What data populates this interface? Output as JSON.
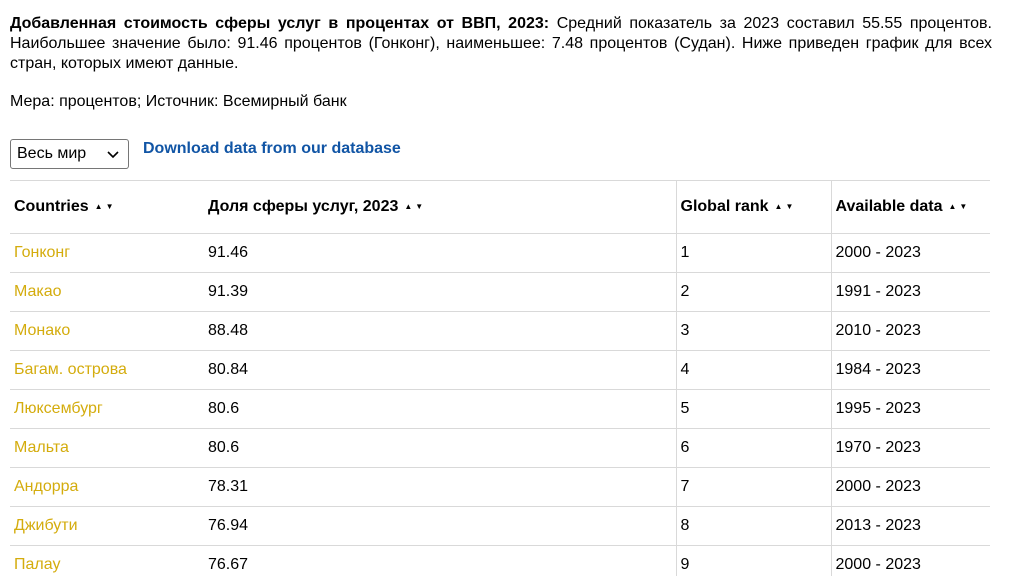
{
  "intro": {
    "title": "Добавленная стоимость сферы услуг в процентах от ВВП, 2023:",
    "text": "Средний показатель за 2023 составил 55.55 процентов. Наибольшее значение было: 91.46 процентов (Гонконг), наименьшее: 7.48 процентов (Судан). Ниже приведен график для всех стран, которых имеют данные."
  },
  "measure": "Мера: процентов; Источник: Всемирный банк",
  "region_select": {
    "value": "Весь мир",
    "icon": "chevron-down-icon"
  },
  "download_link": "Download data from our database",
  "colors": {
    "link": "#1155a5",
    "country": "#d4ac0d",
    "grid": "#d9d9d9"
  },
  "table": {
    "headers": {
      "country": "Countries",
      "value": "Доля сферы услуг, 2023",
      "rank": "Global rank",
      "available": "Available data"
    },
    "sort_arrows": "▲▼",
    "rows": [
      {
        "country": "Гонконг",
        "value": "91.46",
        "rank": "1",
        "available": "2000 - 2023"
      },
      {
        "country": "Макао",
        "value": "91.39",
        "rank": "2",
        "available": "1991 - 2023"
      },
      {
        "country": "Монако",
        "value": "88.48",
        "rank": "3",
        "available": "2010 - 2023"
      },
      {
        "country": "Багам. острова",
        "value": "80.84",
        "rank": "4",
        "available": "1984 - 2023"
      },
      {
        "country": "Люксембург",
        "value": "80.6",
        "rank": "5",
        "available": "1995 - 2023"
      },
      {
        "country": "Мальта",
        "value": "80.6",
        "rank": "6",
        "available": "1970 - 2023"
      },
      {
        "country": "Андорра",
        "value": "78.31",
        "rank": "7",
        "available": "2000 - 2023"
      },
      {
        "country": "Джибути",
        "value": "76.94",
        "rank": "8",
        "available": "2013 - 2023"
      },
      {
        "country": "Палау",
        "value": "76.67",
        "rank": "9",
        "available": "2000 - 2023"
      }
    ]
  }
}
